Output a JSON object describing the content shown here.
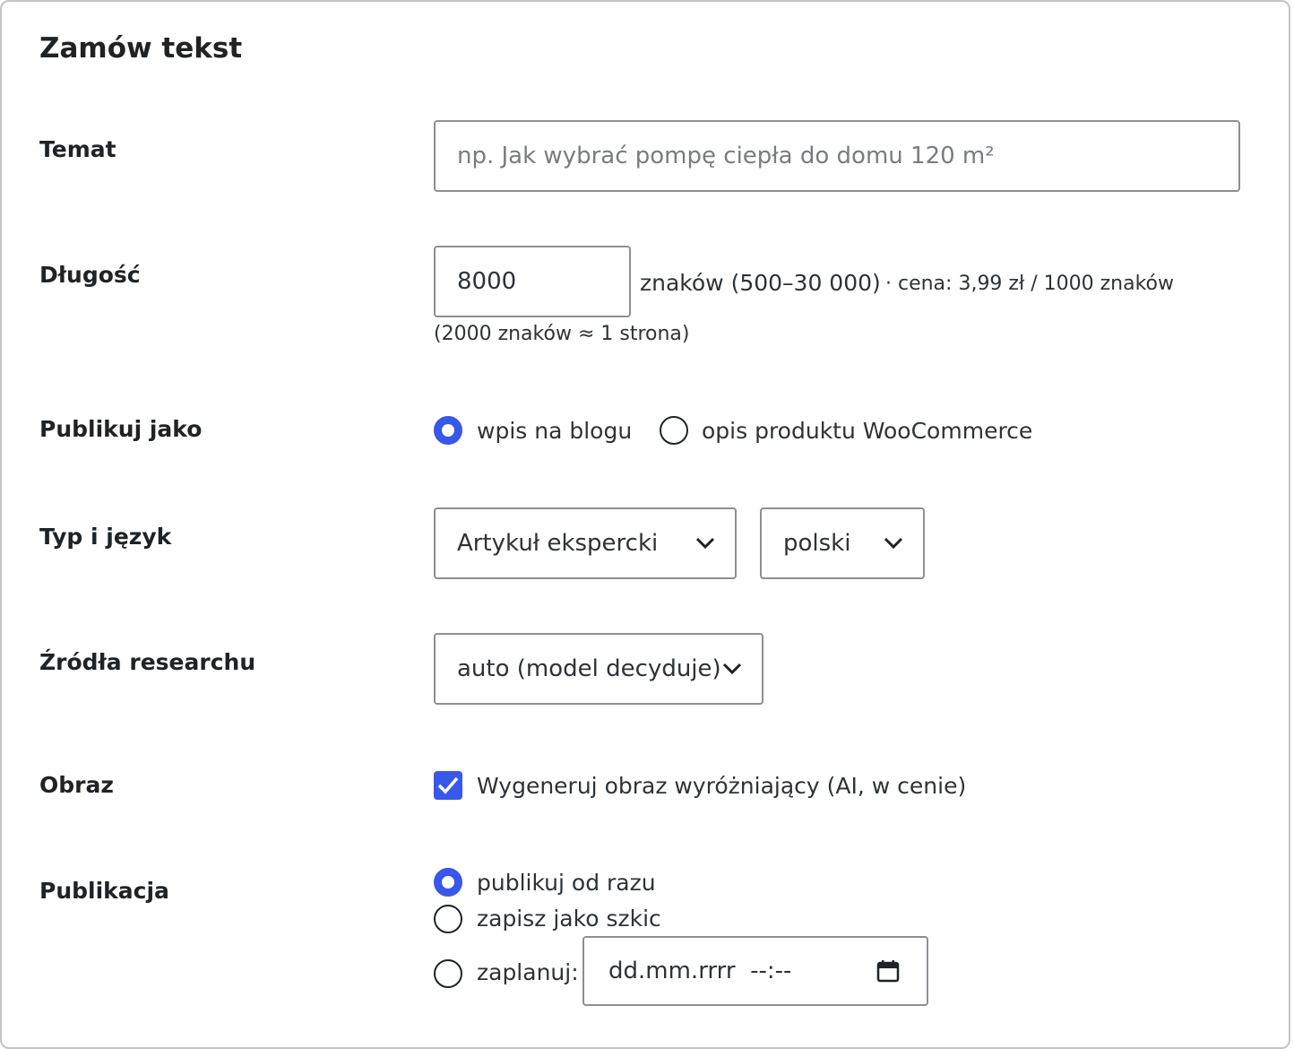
{
  "title": "Zamów tekst",
  "labels": {
    "topic": "Temat",
    "length": "Długość",
    "publish_as": "Publikuj jako",
    "type_lang": "Typ i język",
    "sources": "Źródła researchu",
    "image": "Obraz",
    "publication": "Publikacja"
  },
  "topic": {
    "placeholder": "np. Jak wybrać pompę ciepła do domu 120 m²",
    "value": ""
  },
  "length": {
    "value": "8000",
    "unit_text": "znaków (500–30 000)",
    "price_text": "· cena: 3,99 zł / 1000 znaków",
    "hint": "(2000 znaków ≈ 1 strona)"
  },
  "publish_as": {
    "options": [
      "wpis na blogu",
      "opis produktu WooCommerce"
    ],
    "selected": "wpis na blogu"
  },
  "type_select": {
    "value": "Artykuł ekspercki"
  },
  "language_select": {
    "value": "polski"
  },
  "sources_select": {
    "value": "auto (model decyduje)"
  },
  "image": {
    "checkbox_label": "Wygeneruj obraz wyróżniający (AI, w cenie)",
    "checked": true
  },
  "publication": {
    "options": [
      "publikuj od razu",
      "zapisz jako szkic",
      "zaplanuj:"
    ],
    "selected": "publikuj od razu",
    "datetime_placeholder": "dd.mm.rrrr  --:--"
  },
  "colors": {
    "accent": "#3858e9",
    "border": "#8c8f94",
    "text": "#1d2327"
  },
  "icons": {
    "select_arrow": "chevron-down-icon",
    "date_picker": "calendar-icon",
    "checkbox": "checkmark-icon"
  }
}
